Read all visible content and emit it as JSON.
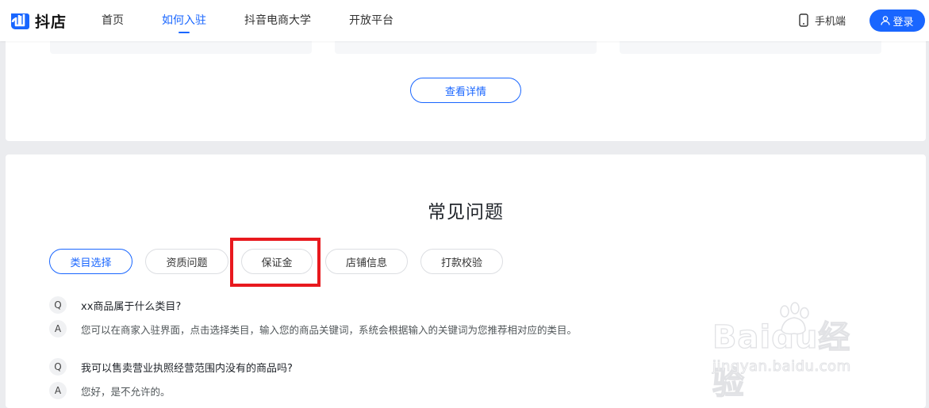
{
  "header": {
    "logo_text": "抖店",
    "nav": [
      {
        "label": "首页",
        "active": false
      },
      {
        "label": "如何入驻",
        "active": true
      },
      {
        "label": "抖音电商大学",
        "active": false
      },
      {
        "label": "开放平台",
        "active": false
      }
    ],
    "mobile_label": "手机端",
    "login_label": "登录"
  },
  "top_section": {
    "details_button": "查看详情"
  },
  "faq": {
    "title": "常见问题",
    "tabs": [
      {
        "label": "类目选择",
        "active": true
      },
      {
        "label": "资质问题",
        "active": false
      },
      {
        "label": "保证金",
        "active": false
      },
      {
        "label": "店铺信息",
        "active": false
      },
      {
        "label": "打款校验",
        "active": false
      }
    ],
    "items": [
      {
        "q_badge": "Q",
        "question": "xx商品属于什么类目?",
        "a_badge": "A",
        "answer": "您可以在商家入驻界面，点击选择类目，输入您的商品关键词，系统会根据输入的关键词为您推荐相对应的类目。"
      },
      {
        "q_badge": "Q",
        "question": "我可以售卖营业执照经营范围内没有的商品吗?",
        "a_badge": "A",
        "answer": "您好，是不允许的。"
      }
    ]
  },
  "watermark": {
    "main": "Baidu经验",
    "sub": "jingyan.baidu.com"
  },
  "colors": {
    "accent": "#1966ff",
    "highlight": "#e8191e",
    "page_bg": "#ebecef"
  }
}
